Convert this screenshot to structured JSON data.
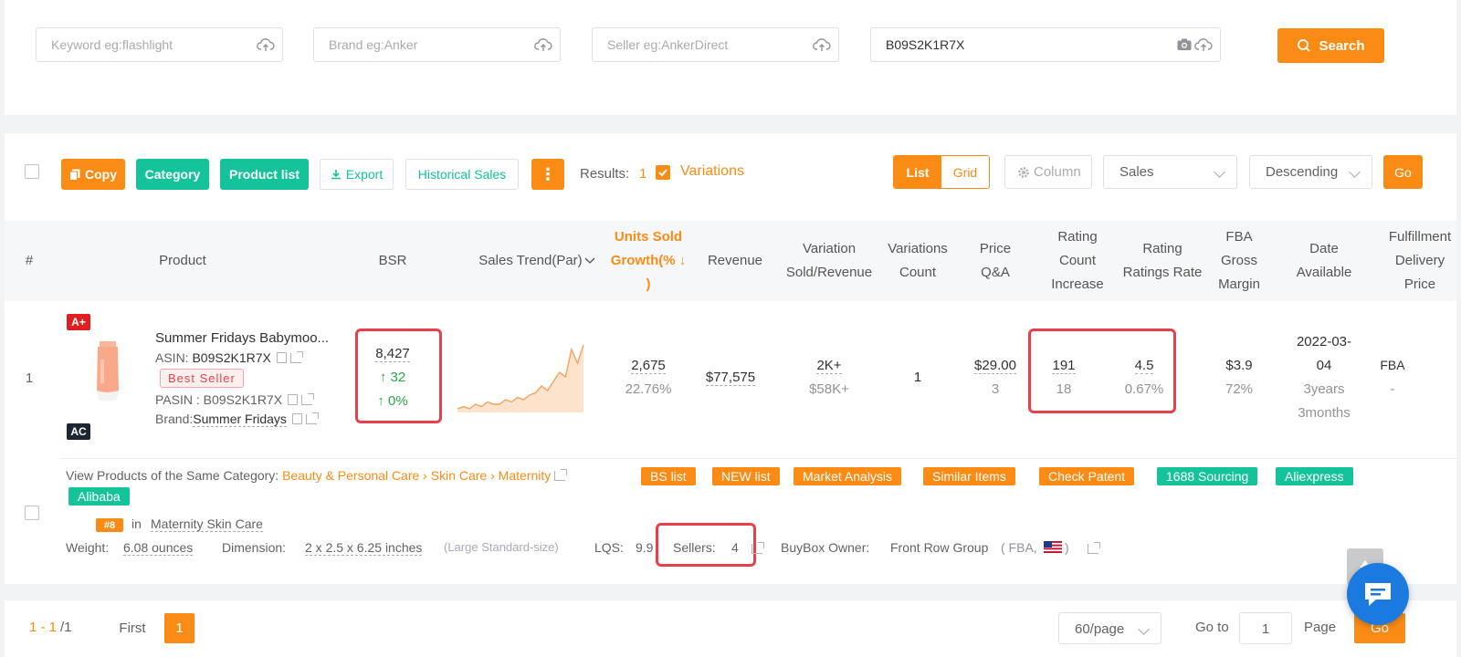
{
  "search": {
    "keyword_placeholder": "Keyword eg:flashlight",
    "brand_placeholder": "Brand eg:Anker",
    "seller_placeholder": "Seller eg:AnkerDirect",
    "asin_value": "B09S2K1R7X",
    "search_label": "Search"
  },
  "toolbar": {
    "copy": "Copy",
    "category": "Category",
    "product_list": "Product list",
    "export": "Export",
    "historical_sales": "Historical Sales",
    "more": "⋮",
    "results_label": "Results:",
    "results_count": "1",
    "variations_label": "Variations",
    "view_list": "List",
    "view_grid": "Grid",
    "column": "Column",
    "sort_field": "Sales",
    "sort_order": "Descending",
    "go": "Go"
  },
  "table": {
    "headers": {
      "num": "#",
      "product": "Product",
      "bsr": "BSR",
      "sales_trend": "Sales Trend(Par)",
      "units_line1": "Units Sold",
      "units_line2": "Growth(% ↓",
      "units_line3": ")",
      "revenue": "Revenue",
      "variation_line1": "Variation",
      "variation_line2": "Sold/Revenue",
      "varcount_line1": "Variations",
      "varcount_line2": "Count",
      "price_line1": "Price",
      "price_line2": "Q&A",
      "ratingcount_line1": "Rating",
      "ratingcount_line2": "Count",
      "ratingcount_line3": "Increase",
      "rating_line1": "Rating",
      "rating_line2": "Ratings Rate",
      "fba_line1": "FBA",
      "fba_line2": "Gross",
      "fba_line3": "Margin",
      "date_line1": "Date",
      "date_line2": "Available",
      "fulfill_line1": "Fulfillment",
      "fulfill_line2": "Delivery",
      "fulfill_line3": "Price"
    },
    "row": {
      "index": "1",
      "badge_aplus": "A+",
      "badge_ac": "AC",
      "title": "Summer Fridays Babymoo...",
      "asin_label": "ASIN:",
      "asin": "B09S2K1R7X",
      "best_seller": "Best Seller",
      "pasin_label": "PASIN :",
      "pasin": "B09S2K1R7X",
      "brand_label": "Brand:",
      "brand": "Summer Fridays",
      "bsr": "8,427",
      "bsr_change": "↑ 32",
      "bsr_pct": "↑ 0%",
      "trend": [
        2,
        3,
        2,
        4,
        3,
        5,
        4,
        4,
        6,
        5,
        7,
        6,
        8,
        9,
        12,
        10,
        14,
        18,
        16,
        28,
        22,
        30
      ],
      "units": "2,675",
      "units_growth": "22.76%",
      "revenue": "$77,575",
      "variation_sold": "2K+",
      "variation_revenue": "$58K+",
      "variations_count": "1",
      "price": "$29.00",
      "qa": "3",
      "rating_count": "191",
      "rating_increase": "18",
      "rating": "4.5",
      "ratings_rate": "0.67%",
      "fba_margin": "$3.9",
      "fba_margin_pct": "72%",
      "date_line1": "2022-03-",
      "date_line2": "04",
      "age_line1": "3years",
      "age_line2": "3months",
      "fulfillment": "FBA",
      "delivery_price": "-"
    },
    "detail": {
      "category_prefix": "View Products of the Same Category:",
      "cat1": "Beauty & Personal Care",
      "cat2": "Skin Care",
      "cat3": "Maternity",
      "tags": {
        "bs_list": "BS list",
        "new_list": "NEW list",
        "market_analysis": "Market Analysis",
        "similar_items": "Similar Items",
        "check_patent": "Check Patent",
        "sourcing_1688": "1688 Sourcing",
        "aliexpress": "Aliexpress",
        "alibaba": "Alibaba"
      },
      "rank": "#8",
      "rank_in": "in",
      "rank_category": "Maternity Skin Care",
      "weight_label": "Weight:",
      "weight": "6.08 ounces",
      "dimension_label": "Dimension:",
      "dimension": "2 x 2.5 x 6.25 inches",
      "size_tier": "(Large Standard-size)",
      "lqs_label": "LQS:",
      "lqs": "9.9",
      "sellers_label": "Sellers:",
      "sellers": "4",
      "buybox_label": "BuyBox Owner:",
      "buybox_owner": "Front Row Group",
      "buybox_type": "( FBA,",
      "buybox_close": ")"
    }
  },
  "pagination": {
    "range_start": "1 - 1",
    "range_total": "/1",
    "first": "First",
    "current_page": "1",
    "page_size": "60/page",
    "goto_label": "Go to",
    "goto_value": "1",
    "page_label": "Page",
    "go": "Go"
  },
  "colors": {
    "accent": "#fa8c16",
    "teal": "#15c39a",
    "highlight_box": "#e8404a"
  }
}
